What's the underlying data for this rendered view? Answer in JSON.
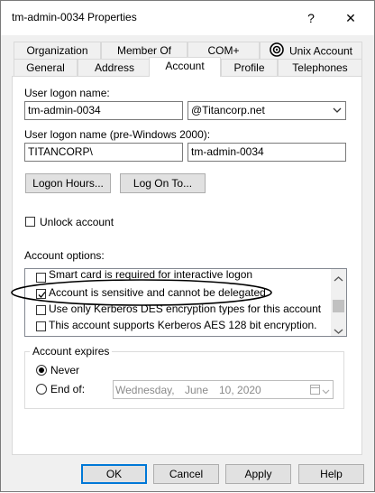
{
  "window": {
    "title": "tm-admin-0034 Properties",
    "help_label": "?",
    "close_label": "✕"
  },
  "tabs": {
    "row1": [
      "Organization",
      "Member Of",
      "COM+",
      "Unix Account"
    ],
    "row2": [
      "General",
      "Address",
      "Account",
      "Profile",
      "Telephones"
    ]
  },
  "logon": {
    "user_logon_label": "User logon name:",
    "user_logon_value": "tm-admin-0034",
    "domain_value": "@Titancorp.net",
    "pre2000_label": "User logon name (pre-Windows 2000):",
    "pre2000_domain": "TITANCORP\\",
    "pre2000_value": "tm-admin-0034"
  },
  "buttons": {
    "logon_hours": "Logon Hours...",
    "logon_to": "Log On To...",
    "ok": "OK",
    "cancel": "Cancel",
    "apply": "Apply",
    "help": "Help"
  },
  "unlock": {
    "label": "Unlock account",
    "checked": false
  },
  "account_options": {
    "label": "Account options:",
    "items": [
      {
        "label": "Smart card is required for interactive logon",
        "checked": false
      },
      {
        "label": "Account is sensitive and cannot be delegated",
        "checked": true
      },
      {
        "label": "Use only Kerberos DES encryption types for this account",
        "checked": false
      },
      {
        "label": "This account supports Kerberos AES 128 bit encryption.",
        "checked": false
      }
    ]
  },
  "expires": {
    "label": "Account expires",
    "never": "Never",
    "end_of": "End of:",
    "selected": "Never",
    "date_weekday": "Wednesday,",
    "date_month": "June",
    "date_day_year": "10, 2020"
  },
  "colors": {
    "accent": "#0078d7",
    "annotation": "#000000"
  }
}
